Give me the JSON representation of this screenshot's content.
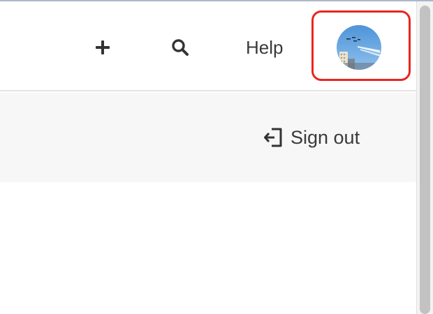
{
  "header": {
    "create_icon": "plus-icon",
    "search_icon": "search-icon",
    "help_label": "Help",
    "avatar_icon": "user-avatar-photo"
  },
  "account_menu": {
    "signout_icon": "sign-out-icon",
    "signout_label": "Sign out"
  },
  "colors": {
    "highlight": "#e8261d",
    "text": "#3a3a3a",
    "menu_background": "#f7f7f7"
  }
}
